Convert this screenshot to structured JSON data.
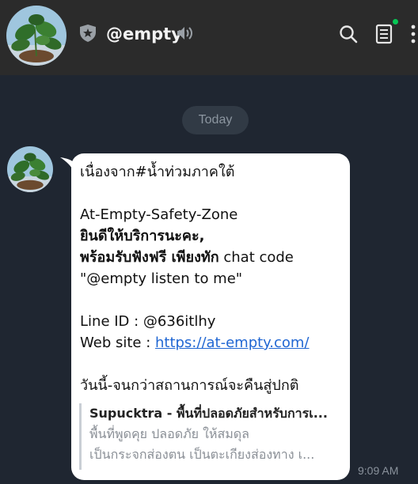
{
  "header": {
    "title": "@empty",
    "icons": [
      "shield-star-icon",
      "speaker-icon",
      "search-icon",
      "notes-icon",
      "more-icon"
    ],
    "online_color": "#06c755"
  },
  "date_chip": "Today",
  "message": {
    "lines": {
      "l1": "เนื่องจาก#น้ำท่วมภาคใต้",
      "l2": "At-Empty-Safety-Zone",
      "l3": "ยินดีให้บริการนะคะ,",
      "l4_bold": "พร้อมรับฟังฟรี เพียงทัก",
      "l4_rest": " chat code",
      "l5": "\"@empty listen to me\"",
      "l6": "Line ID : @636itlhy",
      "l7_label": "Web site : ",
      "l7_link": "https://at-empty.com/",
      "l8": "วันนี้-จนกว่าสถานการณ์จะคืนสู่ปกติ"
    },
    "preview": {
      "site": "Supucktra",
      "title_rest": " - พื้นที่ปลอดภัยสำหรับการเ...",
      "desc1": "พื้นที่พูดคุย ปลอดภัย ให้สมดุล",
      "desc2": "เป็นกระจกส่องตน เป็นตะเกียงส่องทาง เ..."
    },
    "time": "9:09 AM"
  }
}
